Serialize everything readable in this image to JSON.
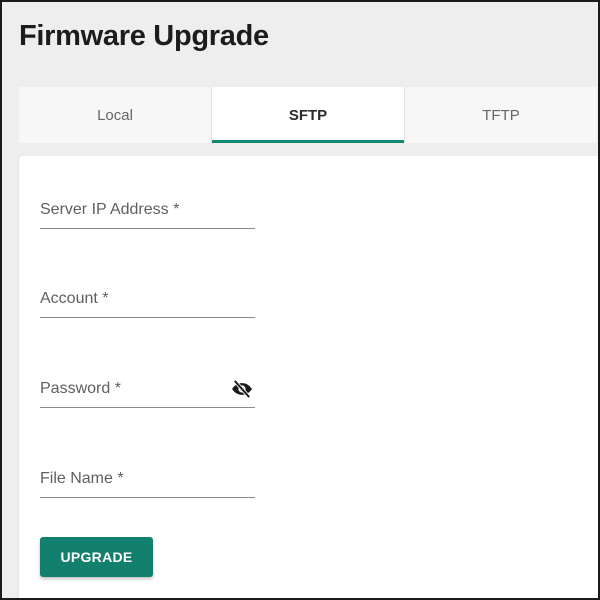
{
  "page": {
    "title": "Firmware Upgrade"
  },
  "tabs": [
    {
      "label": "Local",
      "active": false
    },
    {
      "label": "SFTP",
      "active": true
    },
    {
      "label": "TFTP",
      "active": false
    }
  ],
  "form": {
    "server_ip": {
      "label": "Server IP Address *",
      "value": ""
    },
    "account": {
      "label": "Account *",
      "value": ""
    },
    "password": {
      "label": "Password *",
      "value": "",
      "toggle_icon": "visibility-off-icon"
    },
    "file_name": {
      "label": "File Name *",
      "value": ""
    },
    "upgrade_label": "UPGRADE"
  },
  "colors": {
    "accent": "#128870",
    "button": "#12806c",
    "background": "#eeeeee"
  }
}
